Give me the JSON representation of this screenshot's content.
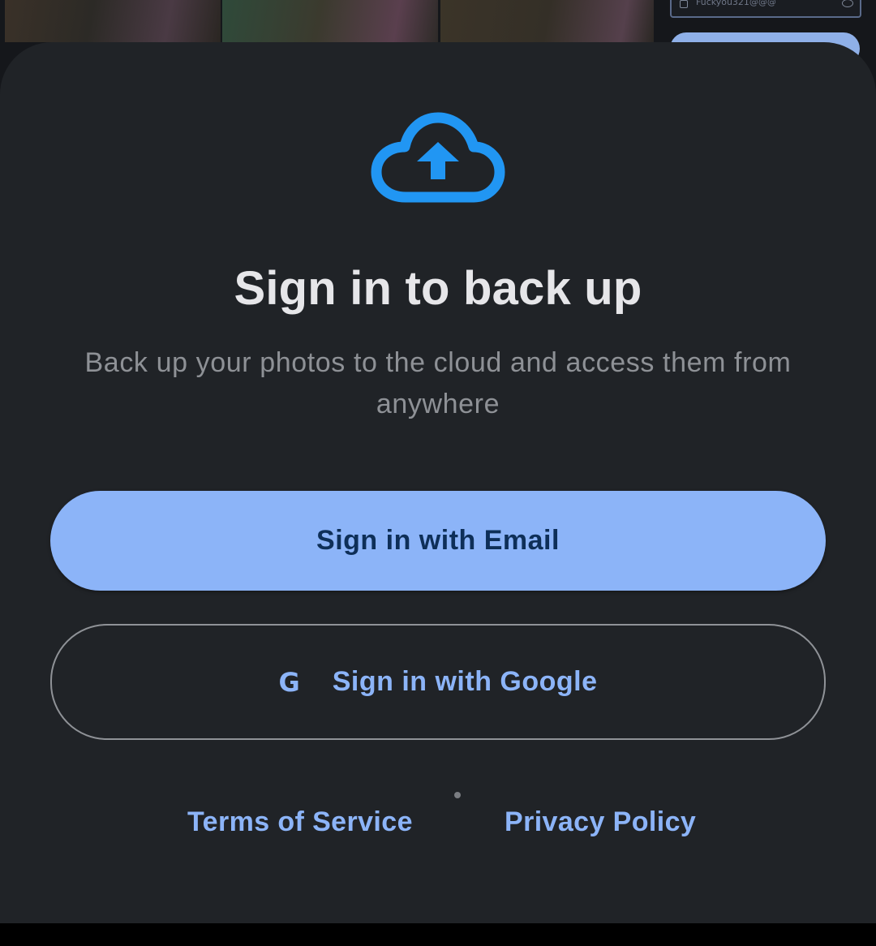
{
  "background": {
    "field_text": "Fuckyou321@@@"
  },
  "sheet": {
    "icon": "cloud-upload-icon",
    "title": "Sign in to back up",
    "subtitle": "Back up your photos to the cloud and access them from anywhere",
    "email_button_label": "Sign in with Email",
    "google_icon": "google-icon",
    "google_glyph": "G",
    "google_button_label": "Sign in with Google",
    "terms_link": "Terms of Service",
    "privacy_link": "Privacy Policy"
  },
  "colors": {
    "sheet_background": "#202327",
    "accent": "#8cb4f8",
    "icon_blue": "#2196f3",
    "email_button_text": "#0e2f58",
    "title_text": "#e6e6e9",
    "subtitle_text": "#8e9196"
  }
}
